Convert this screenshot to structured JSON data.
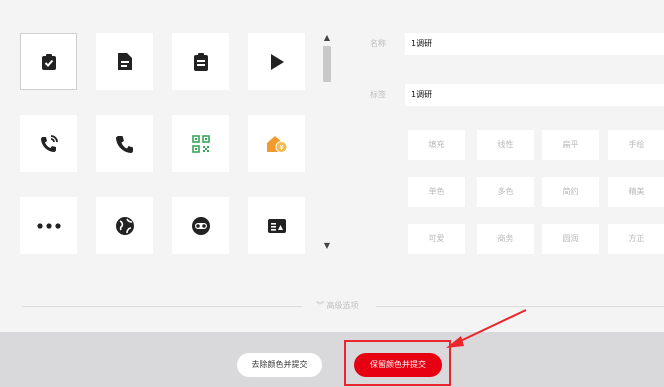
{
  "name_field": {
    "label": "名称",
    "value": "1调研"
  },
  "tag_field": {
    "label": "标签",
    "value": "1调研"
  },
  "tags": [
    "填充",
    "线性",
    "扁平",
    "手绘",
    "单色",
    "多色",
    "简约",
    "精美",
    "可爱",
    "商务",
    "圆润",
    "方正"
  ],
  "icons": [
    {
      "name": "clipboard-check-icon",
      "selected": true
    },
    {
      "name": "document-icon",
      "selected": false
    },
    {
      "name": "clipboard-list-icon",
      "selected": false
    },
    {
      "name": "play-icon",
      "selected": false
    },
    {
      "name": "phone-ringing-icon",
      "selected": false
    },
    {
      "name": "phone-icon",
      "selected": false
    },
    {
      "name": "qr-code-icon",
      "selected": false
    },
    {
      "name": "house-coin-icon",
      "selected": false
    },
    {
      "name": "more-dots-icon",
      "selected": false
    },
    {
      "name": "globe-icon",
      "selected": false
    },
    {
      "name": "toggle-icon",
      "selected": false
    },
    {
      "name": "id-card-icon",
      "selected": false
    }
  ],
  "advanced_options": "高级选项",
  "buttons": {
    "strip_color": "去除颜色并提交",
    "keep_color": "保留颜色并提交"
  },
  "colors": {
    "accent": "#e60012",
    "annotation": "#e8262c",
    "icon_green": "#3aa55a",
    "icon_orange": "#f39a2e"
  }
}
